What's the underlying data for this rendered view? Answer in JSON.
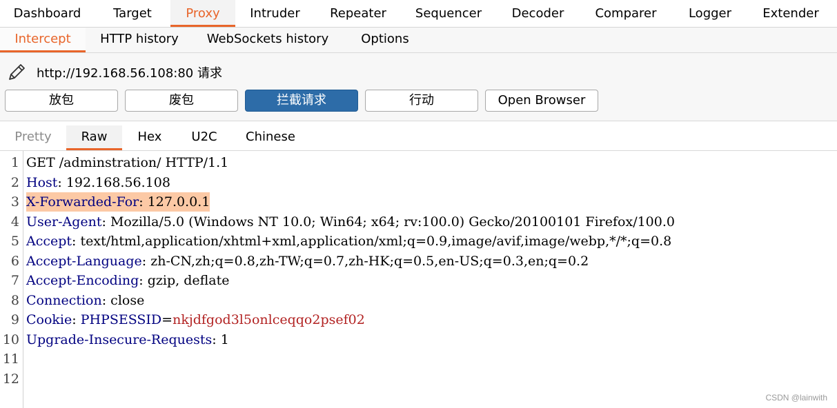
{
  "top_tabs": [
    "Dashboard",
    "Target",
    "Proxy",
    "Intruder",
    "Repeater",
    "Sequencer",
    "Decoder",
    "Comparer",
    "Logger",
    "Extender"
  ],
  "top_active": "Proxy",
  "sub_tabs": [
    "Intercept",
    "HTTP history",
    "WebSockets history",
    "Options"
  ],
  "sub_active": "Intercept",
  "request_title": "http://192.168.56.108:80 请求",
  "buttons": {
    "forward": "放包",
    "drop": "废包",
    "intercept": "拦截请求",
    "action": "行动",
    "open_browser": "Open Browser"
  },
  "editor_tabs": [
    "Pretty",
    "Raw",
    "Hex",
    "U2C",
    "Chinese"
  ],
  "editor_active": "Raw",
  "lines": [
    {
      "n": "1",
      "plain": "GET /adminstration/ HTTP/1.1"
    },
    {
      "n": "2",
      "header": "Host",
      "value": ": 192.168.56.108"
    },
    {
      "n": "3",
      "header": "X-Forwarded-For",
      "value": ": 127.0.0.1",
      "highlight": true
    },
    {
      "n": "4",
      "header": "User-Agent",
      "value": ": Mozilla/5.0 (Windows NT 10.0; Win64; x64; rv:100.0) Gecko/20100101 Firefox/100.0"
    },
    {
      "n": "5",
      "header": "Accept",
      "value": ": text/html,application/xhtml+xml,application/xml;q=0.9,image/avif,image/webp,*/*;q=0.8"
    },
    {
      "n": "6",
      "header": "Accept-Language",
      "value": ": zh-CN,zh;q=0.8,zh-TW;q=0.7,zh-HK;q=0.5,en-US;q=0.3,en;q=0.2"
    },
    {
      "n": "7",
      "header": "Accept-Encoding",
      "value": ": gzip, deflate"
    },
    {
      "n": "8",
      "header": "Connection",
      "value": ": close"
    },
    {
      "n": "9",
      "header": "Cookie",
      "value": ": ",
      "cookie_name": "PHPSESSID",
      "cookie_eq": "=",
      "cookie_value": "nkjdfgod3l5onlceqqo2psef02"
    },
    {
      "n": "10",
      "header": "Upgrade-Insecure-Requests",
      "value": ": 1"
    },
    {
      "n": "11"
    },
    {
      "n": "12"
    }
  ],
  "watermark": "CSDN @lainwith",
  "colors": {
    "accent": "#e8652a",
    "primary_button": "#2d6ca8",
    "header_name": "#000080",
    "cookie_value": "#b22222",
    "highlight": "#fcc9a5"
  }
}
